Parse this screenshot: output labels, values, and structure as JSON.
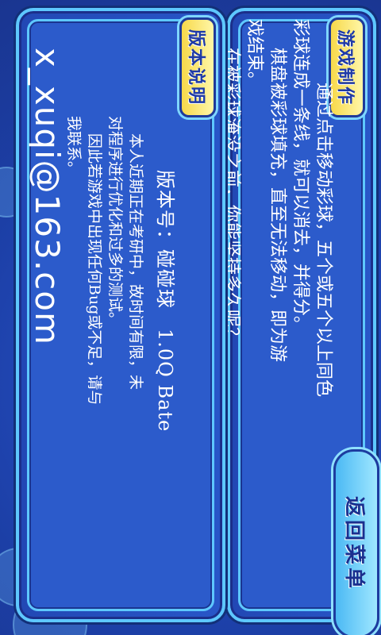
{
  "colors": {
    "background": "#1c3fa6",
    "panel": "#2856c8",
    "panel_border": "#5ec8ff",
    "tag": "#f7d94a",
    "text": "#ffffff"
  },
  "game_section": {
    "tag": "游戏制作",
    "body_lines": [
      "通过点击移动彩球，五个或五个以上同色",
      "彩球连成一条线，就可以消去，并得分。",
      "棋盘被彩球填充，直至无法移动，即为游",
      "戏结束。",
      "在被彩球淹没之前，你能坚持多久呢？"
    ]
  },
  "version_section": {
    "tag": "版本说明",
    "version": "版本号：碰碰球　1.0Q Bate",
    "body_lines": [
      "本人近期正在考研中，故时间有限，未",
      "对程序进行优化和过多的测试。",
      "因此若游戏中出现任何Bug或不足，请与",
      "我联系。"
    ],
    "email": "x_xuqi@163.com"
  },
  "back_button": {
    "label": "返回菜单"
  }
}
